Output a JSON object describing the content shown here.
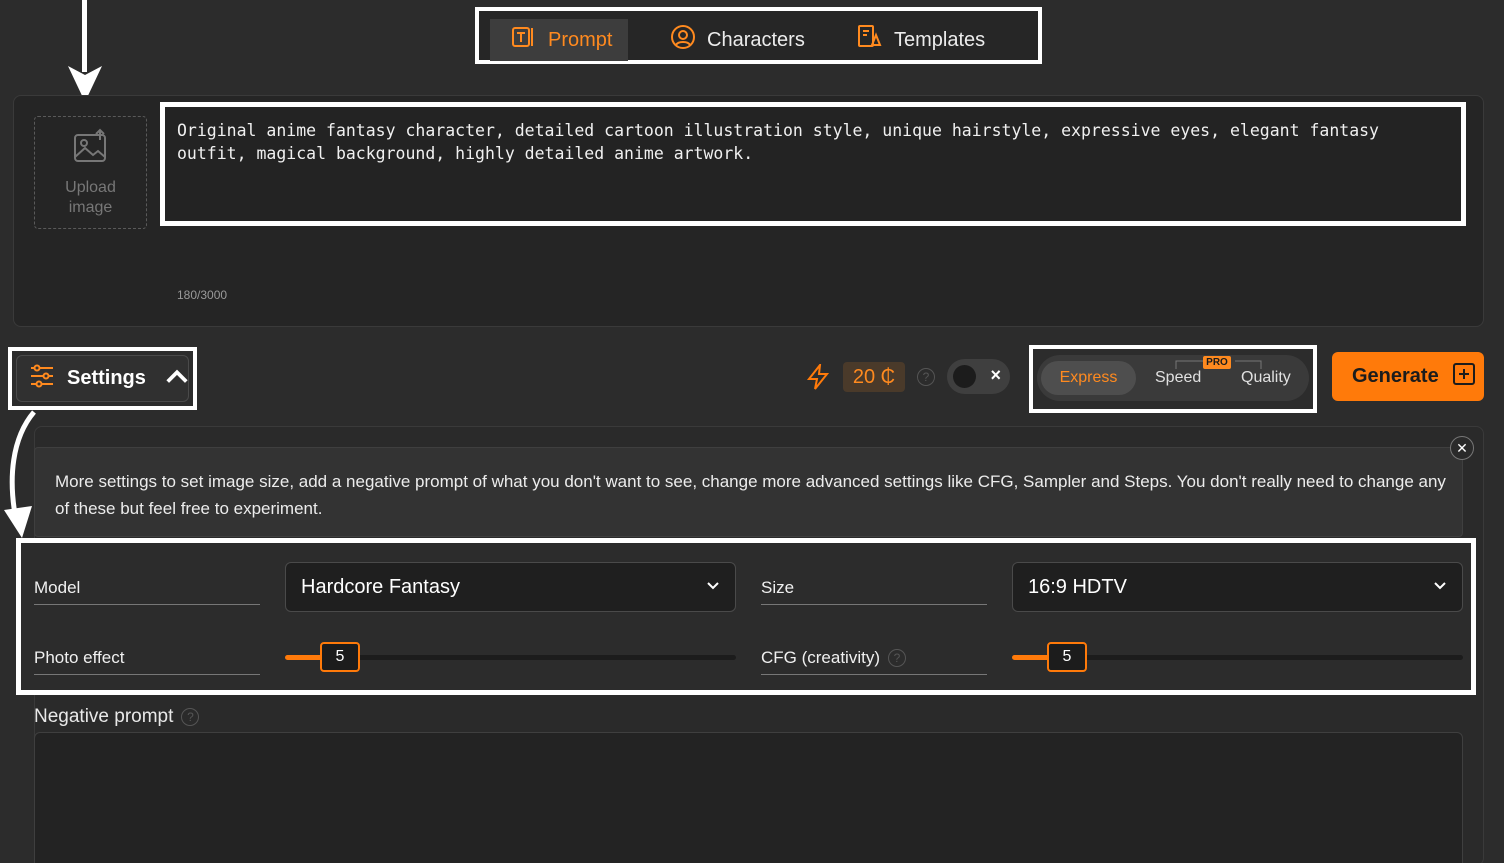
{
  "tabs": [
    {
      "label": "Prompt",
      "icon": "text-frame-icon",
      "active": true
    },
    {
      "label": "Characters",
      "icon": "user-circle-icon",
      "active": false
    },
    {
      "label": "Templates",
      "icon": "template-icon",
      "active": false
    }
  ],
  "upload": {
    "label": "Upload image"
  },
  "prompt": {
    "text": "Original anime fantasy character, detailed cartoon illustration style, unique hairstyle, expressive eyes, elegant fantasy\noutfit, magical background, highly detailed anime artwork.",
    "counter": "180/3000"
  },
  "settings_button": {
    "label": "Settings"
  },
  "credits": {
    "amount": "20 ₵",
    "help": "?"
  },
  "modes": [
    {
      "label": "Express",
      "active": true
    },
    {
      "label": "Speed",
      "active": false
    },
    {
      "label": "Quality",
      "active": false
    }
  ],
  "pro_badge": "PRO",
  "generate": {
    "label": "Generate"
  },
  "settings_panel": {
    "info": "More settings to set image size, add a negative prompt of what you don't want to see, change more advanced settings like CFG, Sampler and Steps. You don't really need to change any of these but feel free to experiment.",
    "model_label": "Model",
    "model_value": "Hardcore Fantasy",
    "size_label": "Size",
    "size_value": "16:9 HDTV",
    "photo_effect_label": "Photo effect",
    "photo_effect_value": "5",
    "cfg_label": "CFG (creativity)",
    "cfg_value": "5",
    "negative_prompt_label": "Negative prompt",
    "negative_prompt_value": ""
  },
  "colors": {
    "accent": "#ff7a0a",
    "background": "#2c2c2c"
  }
}
